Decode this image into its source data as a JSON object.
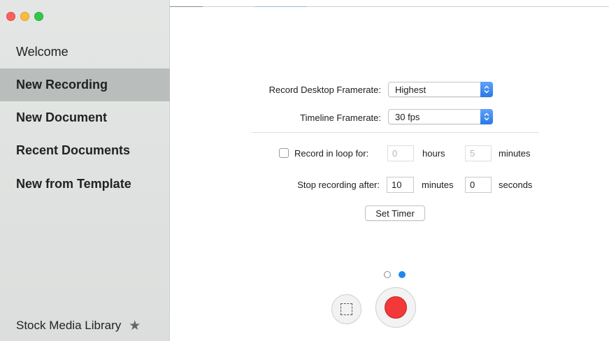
{
  "window": {
    "controls": [
      "close",
      "minimize",
      "zoom"
    ],
    "colors": {
      "close": "#fc605c",
      "minimize": "#fdbc40",
      "zoom": "#34c84a"
    }
  },
  "sidebar": {
    "items": [
      {
        "label": "Welcome",
        "selected": false
      },
      {
        "label": "New Recording",
        "selected": true
      },
      {
        "label": "New Document",
        "selected": false
      },
      {
        "label": "Recent Documents",
        "selected": false
      },
      {
        "label": "New from Template",
        "selected": false
      }
    ],
    "stock_label": "Stock Media Library",
    "stock_icon": "star-icon"
  },
  "settings": {
    "desktop_framerate_label": "Record Desktop Framerate:",
    "desktop_framerate_value": "Highest",
    "timeline_framerate_label": "Timeline Framerate:",
    "timeline_framerate_value": "30 fps",
    "loop_label": "Record in loop for:",
    "loop_checked": false,
    "loop_hours_value": "0",
    "loop_hours_unit": "hours",
    "loop_minutes_value": "5",
    "loop_minutes_unit": "minutes",
    "stop_label": "Stop recording after:",
    "stop_minutes_value": "10",
    "stop_minutes_unit": "minutes",
    "stop_seconds_value": "0",
    "stop_seconds_unit": "seconds",
    "set_timer_label": "Set Timer"
  },
  "pager": {
    "pages": 2,
    "current": 2
  },
  "colors": {
    "accent": "#1e88ee",
    "record": "#f23838",
    "selected_row": "#b9bdbb"
  }
}
